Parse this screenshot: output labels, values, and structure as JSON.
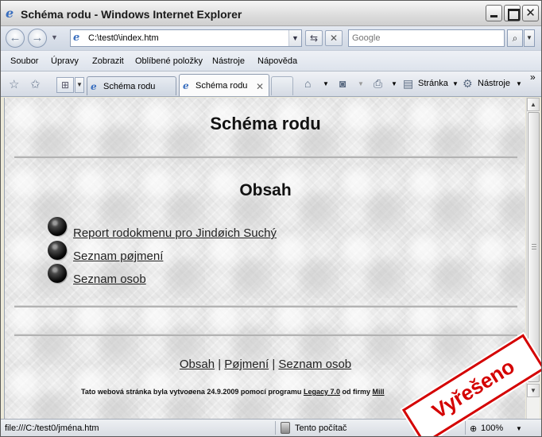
{
  "window": {
    "title": "Schéma rodu - Windows Internet Explorer"
  },
  "address_bar": {
    "url": "C:\\test0\\index.htm",
    "search_placeholder": "Google"
  },
  "menu": {
    "items": [
      "Soubor",
      "Úpravy",
      "Zobrazit",
      "Oblíbené položky",
      "Nástroje",
      "Nápověda"
    ]
  },
  "tabs": [
    {
      "label": "Schéma rodu",
      "active": false
    },
    {
      "label": "Schéma rodu",
      "active": true
    }
  ],
  "commands": {
    "page_label": "Stránka",
    "tools_label": "Nástroje",
    "more": "»"
  },
  "page": {
    "title": "Schéma rodu",
    "section_title": "Obsah",
    "links": [
      "Report rodokmenu pro Jindøich Suchý",
      "Seznam pøjmení",
      "Seznam osob"
    ],
    "footer_nav": [
      "Obsah",
      "Pøjmení",
      "Seznam osob"
    ],
    "footer_sep": "|",
    "credit_text": "Tato webová stránka byla vytvoøena 24.9.2009 pomocí programu",
    "credit_program": "Legacy 7.0",
    "credit_from": "od firmy",
    "credit_company": "Mill"
  },
  "status": {
    "text": "file:///C:/test0/jména.htm",
    "zone": "Tento počítač",
    "zoom": "100%"
  },
  "stamp": {
    "text": "Vyřešeno"
  }
}
